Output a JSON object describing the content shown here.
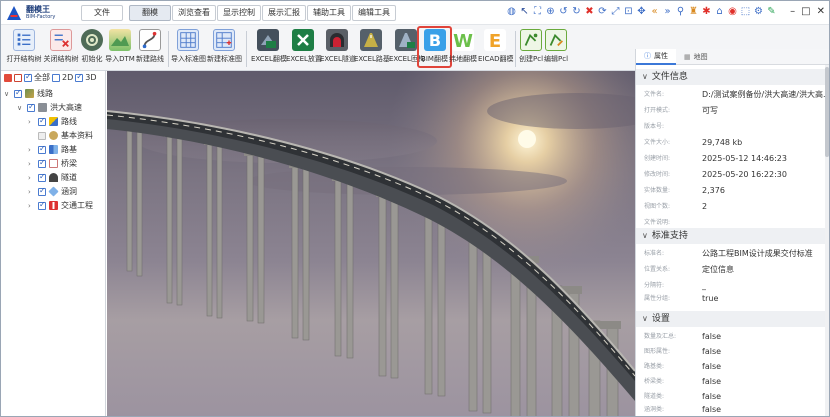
{
  "app": {
    "logo_name": "翻模王",
    "logo_sub": "BIM-Factory"
  },
  "menu": {
    "tabs": [
      {
        "label": "文件"
      },
      {
        "label": "翻模"
      },
      {
        "label": "浏览查看"
      },
      {
        "label": "显示控制"
      },
      {
        "label": "展示汇报"
      },
      {
        "label": "辅助工具"
      },
      {
        "label": "编辑工具"
      }
    ],
    "active_index": 1
  },
  "toolbar_icons": [
    "globe-icon",
    "pointer-icon",
    "fit-view-icon",
    "zoom-icon",
    "rotate-ccw-icon",
    "rotate-cw-icon",
    "delete-icon",
    "refresh-icon",
    "fullscreen-icon",
    "zoom-region-icon",
    "pan-icon",
    "prev-icon",
    "next-icon",
    "walk-icon",
    "person-icon",
    "bug-icon",
    "tag-icon",
    "snapshot-icon",
    "select-icon",
    "settings-icon",
    "brush-icon"
  ],
  "ribbon": {
    "buttons": [
      {
        "label": "打开结构树"
      },
      {
        "label": "关闭结构树"
      },
      {
        "label": "初始化"
      },
      {
        "label": "导入DTM"
      },
      {
        "label": "新建路线"
      },
      {
        "label": "导入标准图"
      },
      {
        "label": "新建标准图"
      },
      {
        "label": "EXCEL翻模"
      },
      {
        "label": "EXCEL放置"
      },
      {
        "label": "EXCEL隧道"
      },
      {
        "label": "EXCEL路基"
      },
      {
        "label": "EXCEL匝构"
      },
      {
        "label": "BIM翻模"
      },
      {
        "label": "纬地翻模"
      },
      {
        "label": "EICAD翻模"
      },
      {
        "label": "创建Pcl"
      },
      {
        "label": "编辑Pcl"
      }
    ]
  },
  "tree": {
    "toolbar": {
      "all": "全部",
      "d2": "2D",
      "d3": "3D"
    },
    "items": [
      {
        "label": "线路"
      },
      {
        "label": "洪大高速"
      },
      {
        "label": "路线"
      },
      {
        "label": "基本资料"
      },
      {
        "label": "路基"
      },
      {
        "label": "桥梁"
      },
      {
        "label": "隧道"
      },
      {
        "label": "涵洞"
      },
      {
        "label": "交通工程"
      }
    ]
  },
  "properties": {
    "tabs": [
      {
        "label": "属性"
      },
      {
        "label": "地图"
      }
    ],
    "sections": [
      {
        "title": "文件信息",
        "rows": [
          {
            "key": "文件名:",
            "value": "D:/测试案例备份/洪大高速/洪大高..."
          },
          {
            "key": "打开模式:",
            "value": "可写"
          },
          {
            "key": "版本号:",
            "value": ""
          },
          {
            "key": "文件大小:",
            "value": "29,748 kb"
          },
          {
            "key": "创建时间:",
            "value": "2025-05-12 14:46:23"
          },
          {
            "key": "修改时间:",
            "value": "2025-05-20 16:22:30"
          },
          {
            "key": "实体数量:",
            "value": "2,376"
          },
          {
            "key": "视图个数:",
            "value": "2"
          },
          {
            "key": "文件说明:",
            "value": ""
          }
        ]
      },
      {
        "title": "标准支持",
        "rows": [
          {
            "key": "标准名:",
            "value": "公路工程BIM设计成果交付标准"
          },
          {
            "key": "位置关系:",
            "value": "定位信息"
          },
          {
            "key": "分隔符:",
            "value": "_"
          },
          {
            "key": "属性分组:",
            "value": "true"
          }
        ]
      },
      {
        "title": "设置",
        "rows": [
          {
            "key": "数量及汇总:",
            "value": "false"
          },
          {
            "key": "图形属性:",
            "value": "false"
          },
          {
            "key": "路基类:",
            "value": "false"
          },
          {
            "key": "桥梁类:",
            "value": "false"
          },
          {
            "key": "隧道类:",
            "value": "false"
          },
          {
            "key": "涵洞类:",
            "value": "false"
          }
        ]
      }
    ]
  },
  "colors": {
    "accent": "#3b78d8",
    "highlight": "#e0443a",
    "sky_top": "#5f5a6b",
    "bridge_deck": "#3a3d42"
  }
}
